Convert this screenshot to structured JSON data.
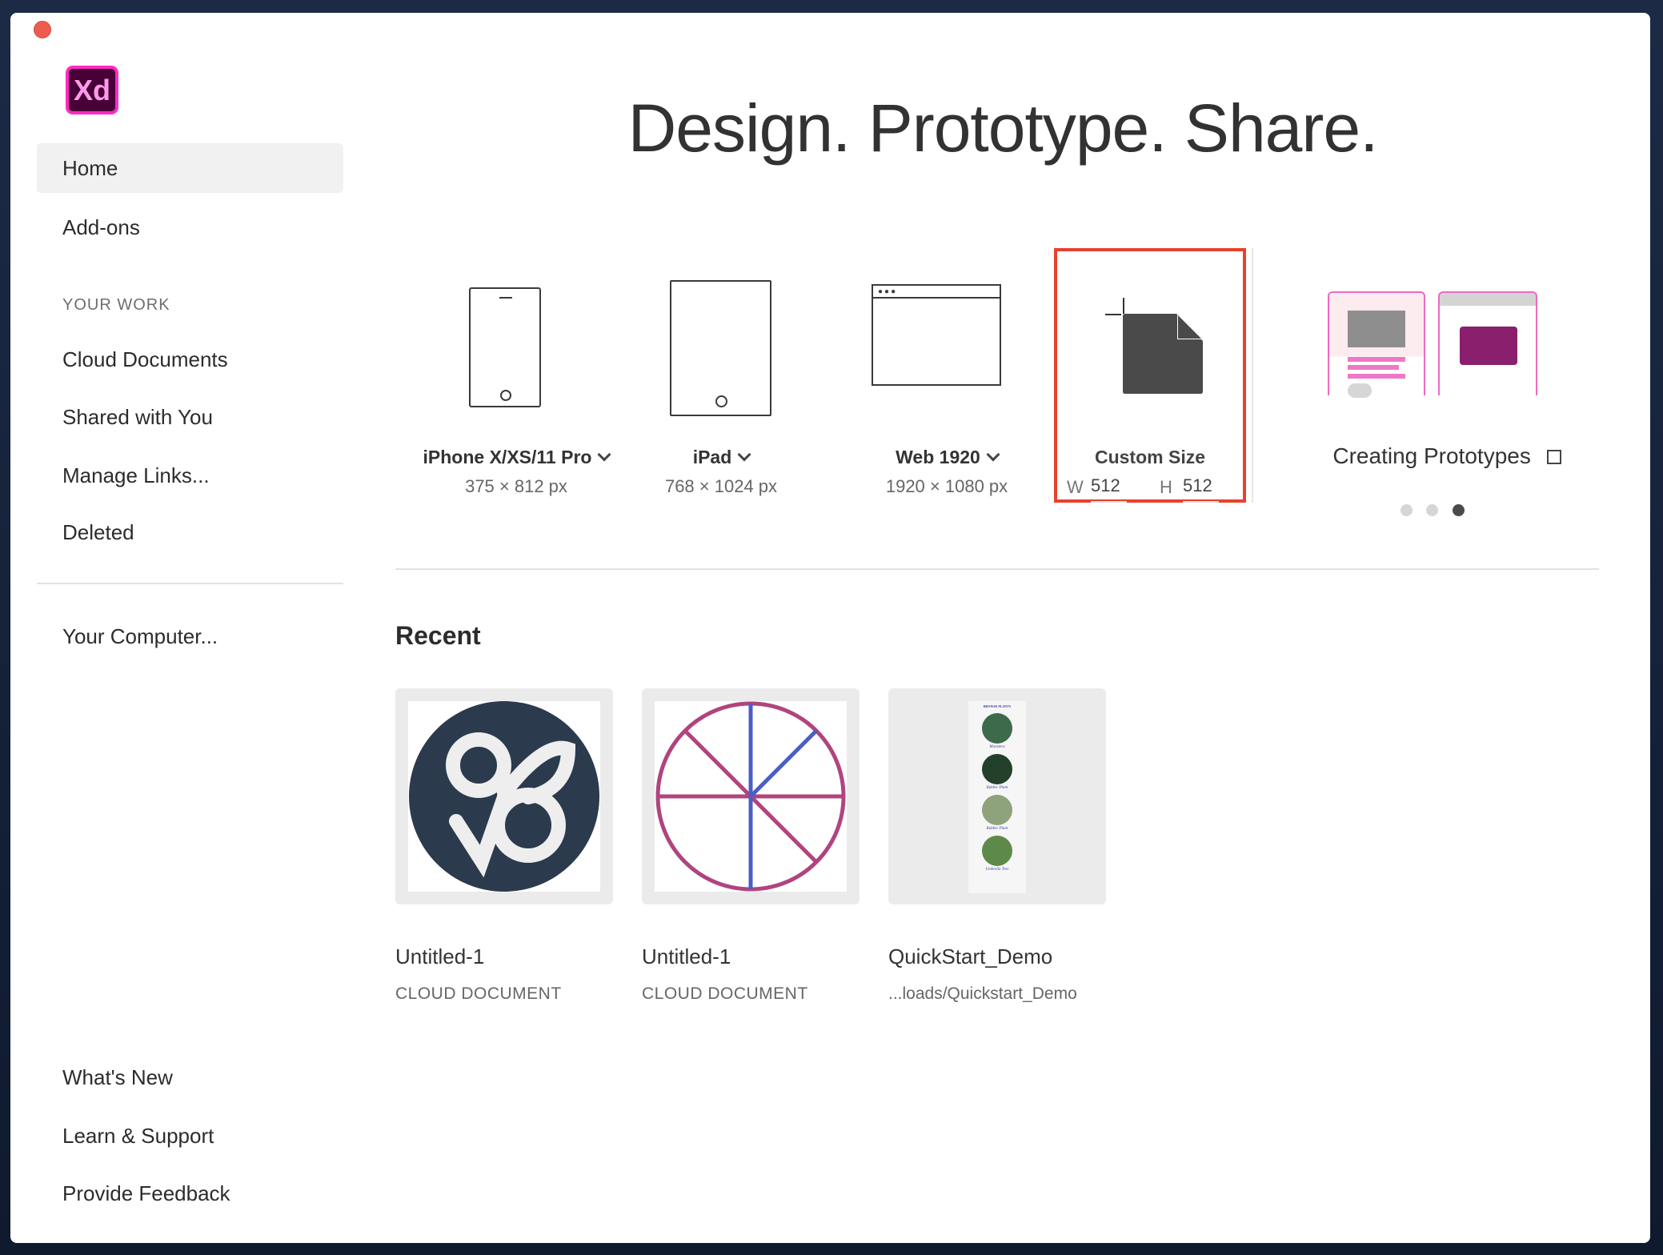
{
  "app": {
    "logo_text": "Xd",
    "headline": "Design. Prototype. Share."
  },
  "sidebar": {
    "top": [
      {
        "label": "Home",
        "active": true
      },
      {
        "label": "Add-ons"
      }
    ],
    "section_label": "YOUR WORK",
    "work": [
      {
        "label": "Cloud Documents"
      },
      {
        "label": "Shared with You"
      },
      {
        "label": "Manage Links..."
      },
      {
        "label": "Deleted"
      }
    ],
    "computer": "Your Computer...",
    "bottom": [
      {
        "label": "What's New"
      },
      {
        "label": "Learn & Support"
      },
      {
        "label": "Provide Feedback"
      }
    ]
  },
  "presets": [
    {
      "label": "iPhone X/XS/11 Pro",
      "size": "375 × 812 px"
    },
    {
      "label": "iPad",
      "size": "768 × 1024 px"
    },
    {
      "label": "Web 1920",
      "size": "1920 × 1080 px"
    }
  ],
  "custom": {
    "label": "Custom Size",
    "w_label": "W",
    "w": "512",
    "h_label": "H",
    "h": "512"
  },
  "tutorial": {
    "label": "Creating Prototypes",
    "page": 3,
    "pages": 3
  },
  "recent": {
    "title": "Recent",
    "items": [
      {
        "name": "Untitled-1",
        "sub": "CLOUD DOCUMENT"
      },
      {
        "name": "Untitled-1",
        "sub": "CLOUD DOCUMENT"
      },
      {
        "name": "QuickStart_Demo",
        "sub": "...loads/Quickstart_Demo",
        "preview_title": "BROWSE PLANTS",
        "preview_items": [
          "Monstera",
          "Rubber Plant",
          "Rubber Plant",
          "Umbrella Tree"
        ]
      }
    ]
  },
  "colors": {
    "highlight": "#e8412c",
    "accent": "#ff2bc2"
  }
}
